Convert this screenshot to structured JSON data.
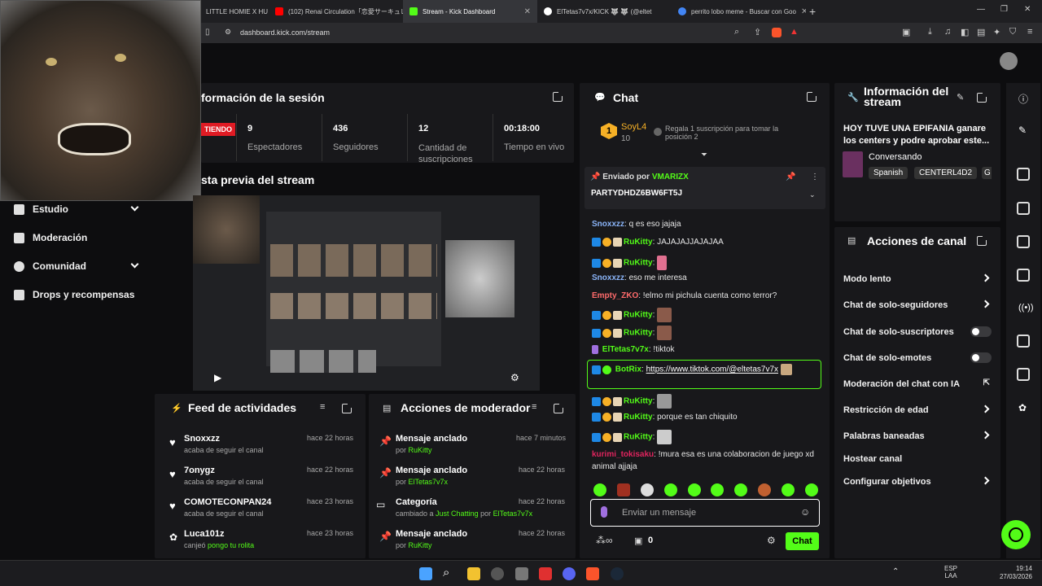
{
  "browser": {
    "tabs": [
      {
        "title": "LITTLE HOMIE X HU",
        "color": "#e33"
      },
      {
        "title": "(102) Renai Circulation「恋愛サーキュレ",
        "color": "#f00"
      },
      {
        "title": "Stream - Kick Dashboard",
        "color": "#53fc18"
      },
      {
        "title": "ElTetas7v7x/KICK 🐺 🐺 (@eltet",
        "color": "#fff"
      },
      {
        "title": "perrito lobo meme - Buscar con Goo",
        "color": "#4285f4"
      }
    ],
    "url": "dashboard.kick.com/stream"
  },
  "sidebar": {
    "items": [
      {
        "label": "Estudio",
        "has_chevron": true
      },
      {
        "label": "Moderación",
        "has_chevron": false
      },
      {
        "label": "Comunidad",
        "has_chevron": true
      },
      {
        "label": "Drops y recompensas",
        "has_chevron": false
      }
    ]
  },
  "session": {
    "title": "formación de la sesión",
    "live_badge": "TIENDO",
    "stats": [
      {
        "value": "9",
        "label": "Espectadores"
      },
      {
        "value": "436",
        "label": "Seguidores"
      },
      {
        "value": "12",
        "label": "Cantidad de suscripciones"
      },
      {
        "value": "00:18:00",
        "label": "Tiempo en vivo"
      }
    ]
  },
  "preview": {
    "title": "sta previa del stream"
  },
  "feed": {
    "title": "Feed de actividades",
    "items": [
      {
        "user": "Snoxxzz",
        "text": "acaba de seguir el canal",
        "time": "hace 22 horas"
      },
      {
        "user": "7onygz",
        "text": "acaba de seguir el canal",
        "time": "hace 22 horas"
      },
      {
        "user": "COMOTECONPAN24",
        "text": "acaba de seguir el canal",
        "time": "hace 23 horas"
      },
      {
        "user": "Luca101z",
        "text_prefix": "canjeó",
        "text_highlight": "pongo tu rolita",
        "time": "hace 23 horas"
      }
    ]
  },
  "modactions": {
    "title": "Acciones de moderador",
    "items": [
      {
        "title": "Mensaje anclado",
        "prefix": "por",
        "who": "RuKitty",
        "time": "hace 7 minutos"
      },
      {
        "title": "Mensaje anclado",
        "prefix": "por",
        "who": "ElTetas7v7x",
        "time": "hace 22 horas"
      },
      {
        "title": "Categoría",
        "prefix": "cambiado a",
        "who": "Just Chatting",
        "suffix": "por",
        "who2": "ElTetas7v7x",
        "time": "hace 22 horas"
      },
      {
        "title": "Mensaje anclado",
        "prefix": "por",
        "who": "RuKitty",
        "time": "hace 22 horas"
      }
    ]
  },
  "chat": {
    "title": "Chat",
    "top_gifter": {
      "name": "SoyL4",
      "count": "10",
      "rank": "1"
    },
    "gift_prompt": "Regala 1 suscripción para tomar la posición 2",
    "pinned": {
      "prefix": "Enviado por",
      "by": "VMARIZX",
      "text": "PARTYDHDZ6BW6FT5J"
    },
    "messages": [
      {
        "user": "Snoxxzz",
        "color": "#8ab4f8",
        "text": "q es eso jajaja",
        "badges": false
      },
      {
        "user": "RuKitty",
        "color": "#53fc18",
        "text": "JAJAJAJJAJAJAA",
        "badges": true
      },
      {
        "user": "RuKitty",
        "color": "#53fc18",
        "text": "",
        "badges": true,
        "emote": true
      },
      {
        "user": "Snoxxzz",
        "color": "#8ab4f8",
        "text": "eso me interesa",
        "badges": false
      },
      {
        "user": "Empty_ZKO",
        "color": "#ff6b6b",
        "text": "!elmo mi pichula cuenta como terror?",
        "badges": false
      },
      {
        "user": "RuKitty",
        "color": "#53fc18",
        "text": "",
        "badges": true,
        "emote": true
      },
      {
        "user": "RuKitty",
        "color": "#53fc18",
        "text": "",
        "badges": true,
        "emote": true
      },
      {
        "user": "ElTetas7v7x",
        "color": "#53fc18",
        "text": "!tiktok",
        "badges": false
      },
      {
        "user": "BotRix",
        "color": "#53fc18",
        "text": "https://www.tiktok.com/@eltetas7v7x",
        "badges": true
      },
      {
        "user": "RuKitty",
        "color": "#53fc18",
        "text": "",
        "badges": true,
        "emote": true
      },
      {
        "user": "RuKitty",
        "color": "#53fc18",
        "text": "porque es tan chiquito",
        "badges": true
      },
      {
        "user": "RuKitty",
        "color": "#53fc18",
        "text": "",
        "badges": true,
        "emote": true
      },
      {
        "user": "kurimi_tokisaku",
        "color": "#e0245e",
        "text": "!mura esa es una colaboracion de juego xd animal ajjaja",
        "badges": false
      }
    ],
    "input_placeholder": "Enviar un mensaje",
    "points": "0",
    "send_label": "Chat"
  },
  "streaminfo": {
    "title": "Información del stream",
    "description": "HOY TUVE UNA EPIFANIA ganare los centers y podre aprobar este...",
    "category": "Conversando",
    "tags": [
      "Spanish",
      "CENTERL4D2",
      "G"
    ]
  },
  "channelactions": {
    "title": "Acciones de canal",
    "items": [
      {
        "label": "Modo lento",
        "control": "chevron"
      },
      {
        "label": "Chat de solo-seguidores",
        "control": "chevron"
      },
      {
        "label": "Chat de solo-suscriptores",
        "control": "toggle"
      },
      {
        "label": "Chat de solo-emotes",
        "control": "toggle"
      },
      {
        "label": "Moderación del chat con IA",
        "control": "external"
      },
      {
        "label": "Restricción de edad",
        "control": "chevron"
      },
      {
        "label": "Palabras baneadas",
        "control": "chevron"
      },
      {
        "label": "Hostear canal",
        "control": "none"
      },
      {
        "label": "Configurar objetivos",
        "control": "chevron"
      }
    ]
  },
  "taskbar": {
    "lang": "ESP",
    "lang2": "LAA",
    "time": "19:14",
    "date": "27/03/2026"
  }
}
